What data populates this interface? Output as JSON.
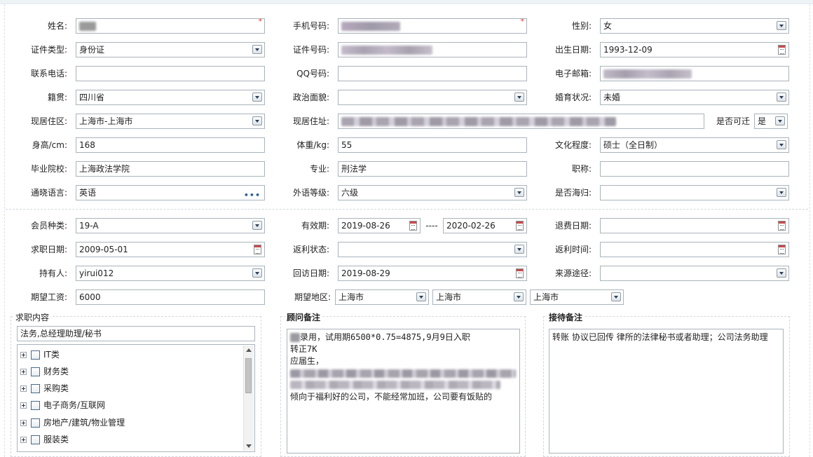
{
  "basic": {
    "name": {
      "label": "姓名:"
    },
    "mobile": {
      "label": "手机号码:"
    },
    "gender": {
      "label": "性别:",
      "value": "女"
    },
    "id_type": {
      "label": "证件类型:",
      "value": "身份证"
    },
    "id_number": {
      "label": "证件号码:"
    },
    "birth_date": {
      "label": "出生日期:",
      "value": "1993-12-09"
    },
    "phone": {
      "label": "联系电话:",
      "value": ""
    },
    "qq": {
      "label": "QQ号码:",
      "value": ""
    },
    "email": {
      "label": "电子邮箱:"
    },
    "native_place": {
      "label": "籍贯:",
      "value": "四川省"
    },
    "political": {
      "label": "政治面貌:",
      "value": ""
    },
    "marital": {
      "label": "婚育状况:",
      "value": "未婚"
    },
    "residence_area": {
      "label": "现居住区:",
      "value": "上海市-上海市"
    },
    "address": {
      "label": "现居住址:"
    },
    "relocatable": {
      "label": "是否可迁",
      "value": "是"
    },
    "height": {
      "label": "身高/cm:",
      "value": "168"
    },
    "weight": {
      "label": "体重/kg:",
      "value": "55"
    },
    "education": {
      "label": "文化程度:",
      "value": "硕士（全日制）"
    },
    "school": {
      "label": "毕业院校:",
      "value": "上海政法学院"
    },
    "major": {
      "label": "专业:",
      "value": "刑法学"
    },
    "title": {
      "label": "职称:",
      "value": ""
    },
    "languages": {
      "label": "通晓语言:",
      "value": "英语"
    },
    "foreign_level": {
      "label": "外语等级:",
      "value": "六级"
    },
    "overseas": {
      "label": "是否海归:",
      "value": ""
    }
  },
  "membership": {
    "member_type": {
      "label": "会员种类:",
      "value": "19-A"
    },
    "valid_period": {
      "label": "有效期:",
      "start": "2019-08-26",
      "separator": "----",
      "end": "2020-02-26"
    },
    "refund_date": {
      "label": "退费日期:",
      "value": ""
    },
    "job_date": {
      "label": "求职日期:",
      "value": "2009-05-01"
    },
    "rebate_status": {
      "label": "返利状态:",
      "value": ""
    },
    "rebate_time": {
      "label": "返利时间:",
      "value": ""
    },
    "holder": {
      "label": "持有人:",
      "value": "yirui012"
    },
    "revisit_date": {
      "label": "回访日期:",
      "value": "2019-08-29"
    },
    "source": {
      "label": "来源途径:",
      "value": ""
    },
    "expected_salary": {
      "label": "期望工资:",
      "value": "6000"
    },
    "expected_area": {
      "label": "期望地区:",
      "values": [
        "上海市",
        "上海市",
        "上海市"
      ]
    }
  },
  "job_content": {
    "title": "求职内容",
    "selected": "法务,总经理助理/秘书",
    "tree": [
      "IT类",
      "财务类",
      "采购类",
      "电子商务/互联网",
      "房地产/建筑/物业管理",
      "服装类"
    ]
  },
  "consultant_notes": {
    "title": "顾问备注",
    "lines": [
      "录用，试用期6500*0.75=4875,9月9日入职",
      "转正7K",
      "应届生，",
      "倾向于福利好的公司，不能经常加班，公司要有饭贴的"
    ]
  },
  "reception_notes": {
    "title": "接待备注",
    "text": "转账 协议已回传 律所的法律秘书或者助理；公司法务助理"
  },
  "colors": {
    "required": "#e33333",
    "border": "#aab4bb",
    "link_dots": "#2d5f96"
  }
}
